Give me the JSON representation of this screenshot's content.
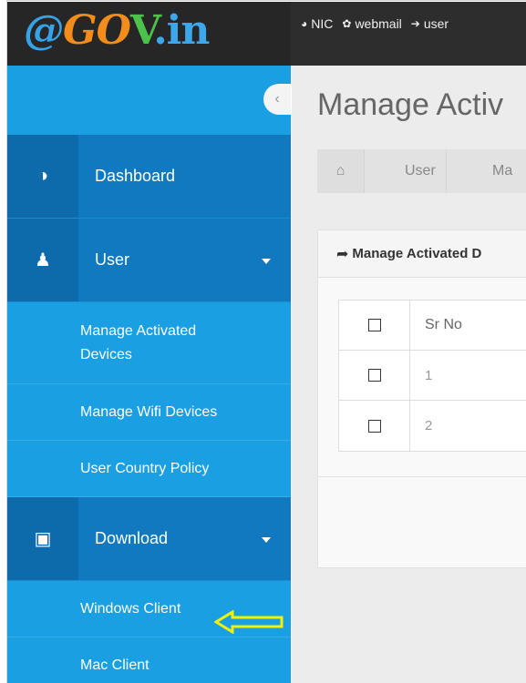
{
  "logo": {
    "at": "@",
    "gov": "GO",
    "check": "V",
    "in": ".in"
  },
  "top_links": [
    {
      "icon": "globe-icon",
      "glyph": "◕",
      "label": "NIC"
    },
    {
      "icon": "envelope-icon",
      "glyph": "✿",
      "label": "webmail"
    },
    {
      "icon": "sign-in-icon",
      "glyph": "➔",
      "label": "user"
    }
  ],
  "sidebar": {
    "collapse_glyph": "‹",
    "menu": [
      {
        "label": "Dashboard",
        "icon": "dashboard-icon",
        "glyph": "◑"
      },
      {
        "label": "User",
        "icon": "user-icon",
        "glyph": "♟",
        "expanded": true,
        "children": [
          {
            "label": "Manage Activated Devices"
          },
          {
            "label": "Manage Wifi Devices"
          },
          {
            "label": "User Country Policy"
          }
        ]
      },
      {
        "label": "Download",
        "icon": "save-icon",
        "glyph": "▣",
        "expanded": true,
        "children": [
          {
            "label": "Windows Client"
          },
          {
            "label": "Mac Client"
          }
        ]
      }
    ]
  },
  "main": {
    "page_title": "Manage Activ",
    "breadcrumb": [
      "User",
      "Ma"
    ],
    "home_glyph": "⌂",
    "panel": {
      "title_glyph": "➦",
      "title": "Manage Activated D",
      "table": {
        "header": "Sr No",
        "rows": [
          "1",
          "2"
        ]
      }
    }
  },
  "colors": {
    "header_bg": "#2d2d2d",
    "sidebar_bg": "#1a9fe3",
    "sidebar_menu_bg": "#1079bf",
    "arrow": "#f4f200"
  }
}
